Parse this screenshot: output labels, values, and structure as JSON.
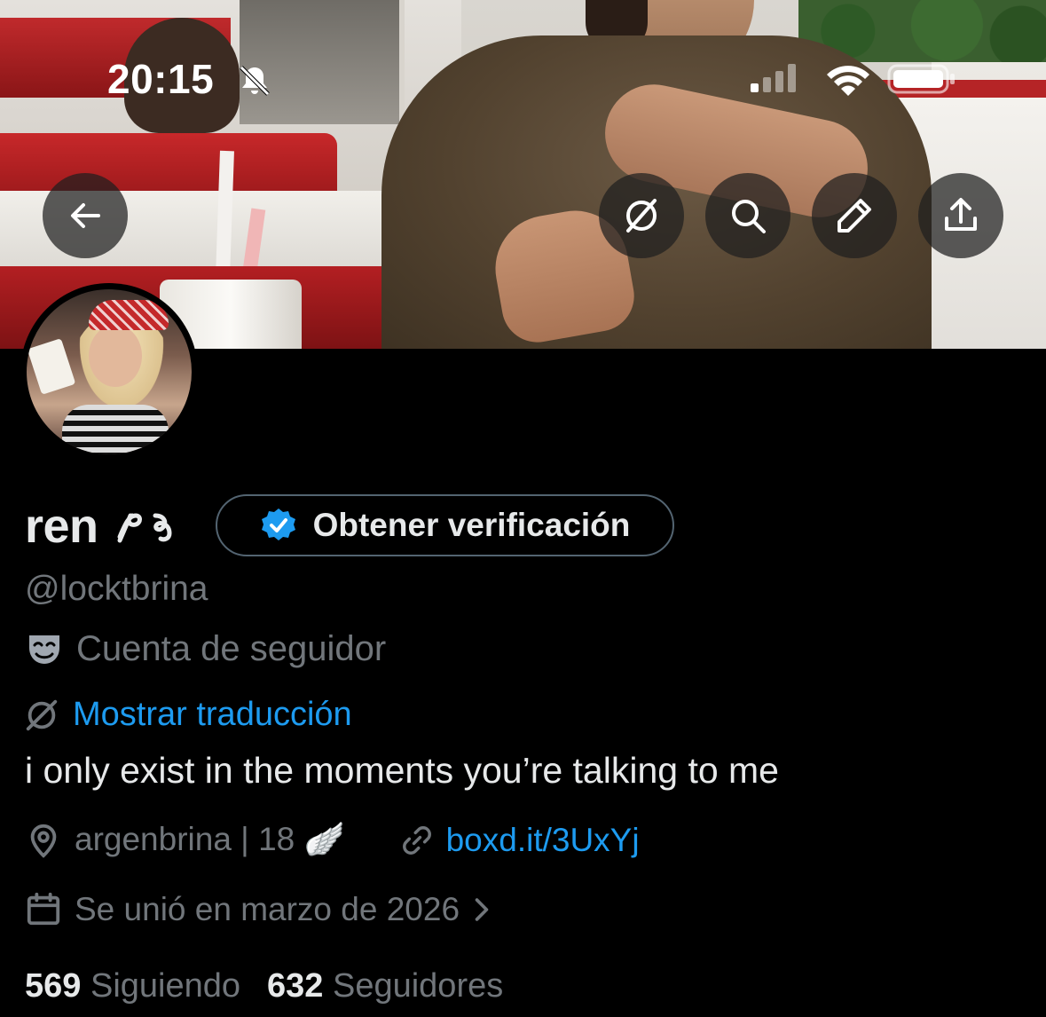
{
  "status_bar": {
    "time": "20:15"
  },
  "profile": {
    "name": "ren",
    "name_glyph": "🎀",
    "verify_button_label": "Obtener verificación",
    "handle": "@locktbrina",
    "account_type": "Cuenta de seguidor",
    "translate_label": "Mostrar traducción",
    "bio": "i only exist in the moments you’re talking to me",
    "location": "argenbrina | 18 🪽",
    "website": "boxd.it/3UxYj",
    "joined": "Se unió en marzo de 2026",
    "following_count": "569",
    "following_label": "Siguiendo",
    "followers_count": "632",
    "followers_label": "Seguidores"
  },
  "colors": {
    "accent": "#1d9bf0",
    "muted": "#71767b",
    "text": "#e7e9ea",
    "background": "#000000"
  },
  "icons": [
    "back-arrow-icon",
    "no-translate-icon",
    "search-icon",
    "edit-pencil-icon",
    "share-icon",
    "verified-badge-icon",
    "theater-mask-icon",
    "location-pin-icon",
    "link-icon",
    "calendar-icon",
    "chevron-right-icon"
  ]
}
